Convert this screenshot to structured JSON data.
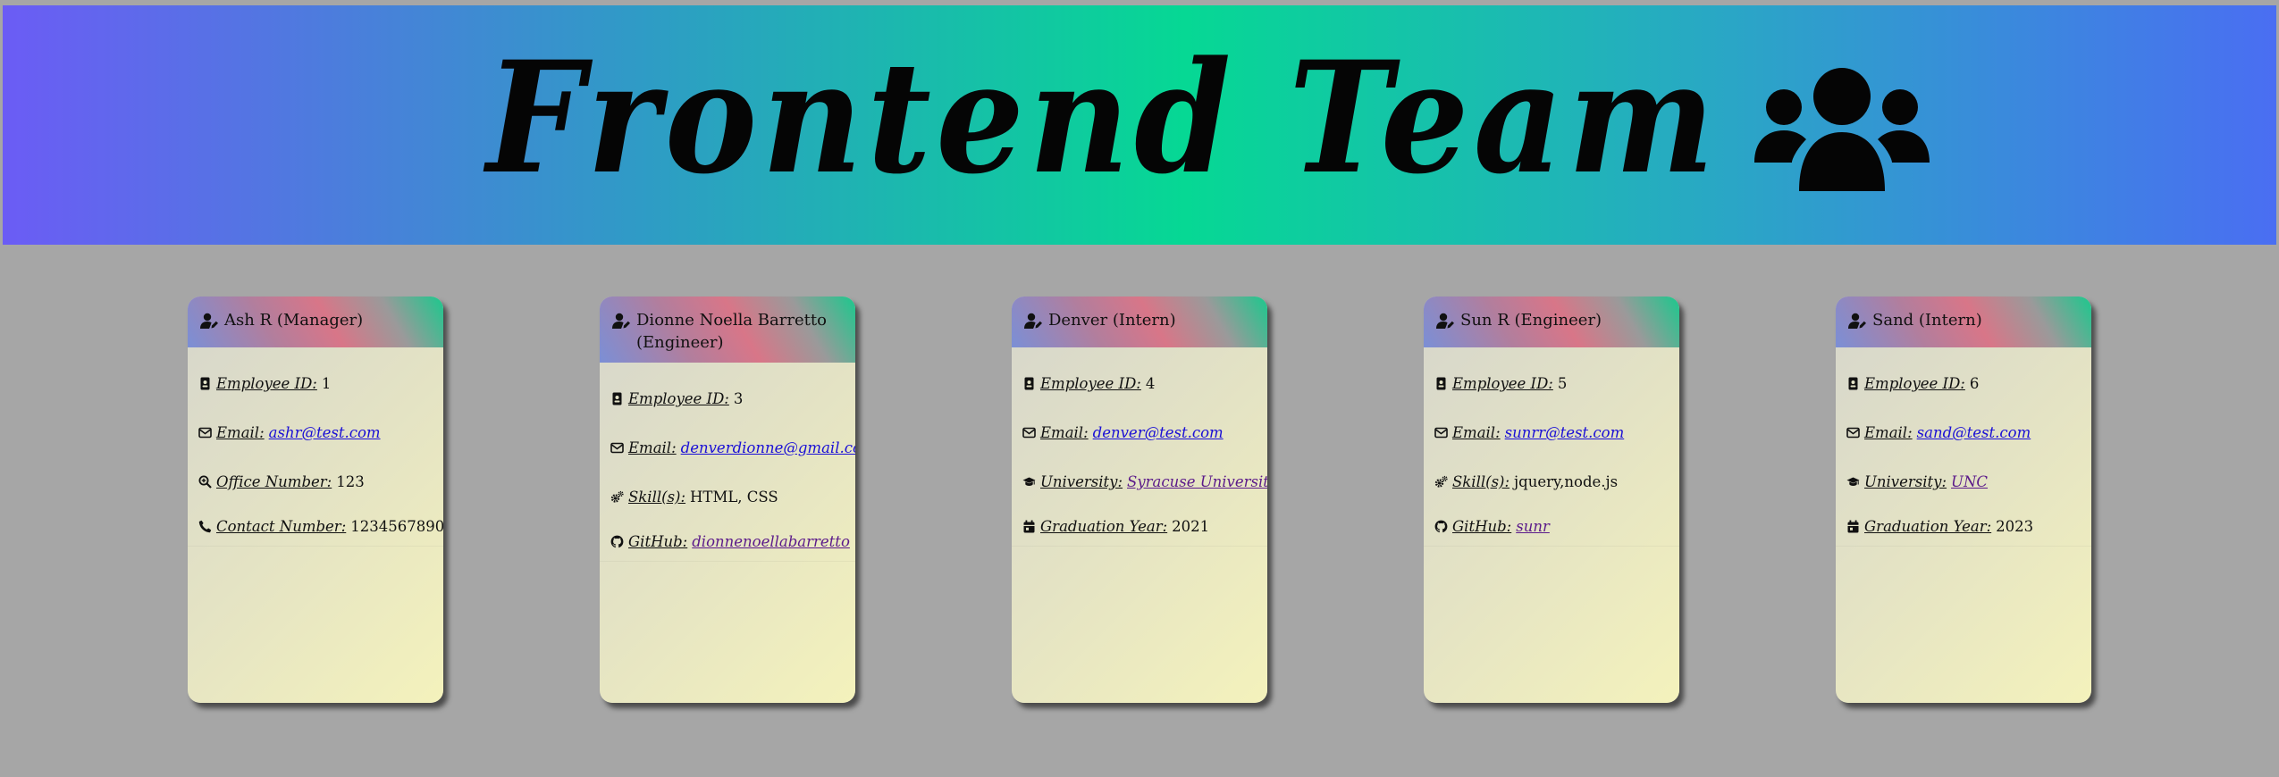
{
  "banner": {
    "title": "Frontend Team",
    "icon": "users-icon"
  },
  "cards": [
    {
      "name": "Ash R (Manager)",
      "fields": [
        {
          "icon": "id-badge-icon",
          "label": "Employee ID:",
          "value": "1",
          "link": false
        },
        {
          "icon": "envelope-icon",
          "label": "Email:",
          "value": "ashr@test.com",
          "link": true
        },
        {
          "icon": "search-icon",
          "label": "Office Number:",
          "value": "123",
          "link": false
        },
        {
          "icon": "phone-icon",
          "label": "Contact Number:",
          "value": "1234567890",
          "link": false
        }
      ]
    },
    {
      "name": "Dionne Noella Barretto (Engineer)",
      "fields": [
        {
          "icon": "id-badge-icon",
          "label": "Employee ID:",
          "value": "3",
          "link": false
        },
        {
          "icon": "envelope-icon",
          "label": "Email:",
          "value": "denverdionne@gmail.com",
          "link": true
        },
        {
          "icon": "cogs-icon",
          "label": "Skill(s):",
          "value": "HTML, CSS",
          "link": false
        },
        {
          "icon": "github-icon",
          "label": "GitHub:",
          "value": "dionnenoellabarretto",
          "link": true
        }
      ]
    },
    {
      "name": "Denver (Intern)",
      "fields": [
        {
          "icon": "id-badge-icon",
          "label": "Employee ID:",
          "value": "4",
          "link": false
        },
        {
          "icon": "envelope-icon",
          "label": "Email:",
          "value": "denver@test.com",
          "link": true
        },
        {
          "icon": "graduation-cap-icon",
          "label": "University:",
          "value": "Syracuse University",
          "link": true
        },
        {
          "icon": "calendar-icon",
          "label": "Graduation Year:",
          "value": "2021",
          "link": false
        }
      ]
    },
    {
      "name": "Sun R (Engineer)",
      "fields": [
        {
          "icon": "id-badge-icon",
          "label": "Employee ID:",
          "value": "5",
          "link": false
        },
        {
          "icon": "envelope-icon",
          "label": "Email:",
          "value": "sunrr@test.com",
          "link": true
        },
        {
          "icon": "cogs-icon",
          "label": "Skill(s):",
          "value": "jquery,node.js",
          "link": false
        },
        {
          "icon": "github-icon",
          "label": "GitHub:",
          "value": "sunr",
          "link": true
        }
      ]
    },
    {
      "name": "Sand (Intern)",
      "fields": [
        {
          "icon": "id-badge-icon",
          "label": "Employee ID:",
          "value": "6",
          "link": false
        },
        {
          "icon": "envelope-icon",
          "label": "Email:",
          "value": "sand@test.com",
          "link": true
        },
        {
          "icon": "graduation-cap-icon",
          "label": "University:",
          "value": "UNC",
          "link": true
        },
        {
          "icon": "calendar-icon",
          "label": "Graduation Year:",
          "value": "2023",
          "link": false
        }
      ]
    }
  ]
}
